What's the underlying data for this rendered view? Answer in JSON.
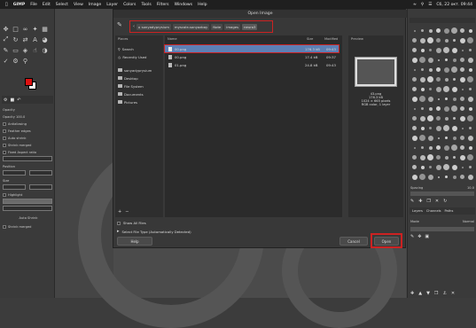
{
  "menubar": {
    "apple": "",
    "items": [
      "GIMP",
      "File",
      "Edit",
      "Select",
      "View",
      "Image",
      "Layer",
      "Colors",
      "Tools",
      "Filters",
      "Windows",
      "Help"
    ],
    "clock": "Сб, 22 окт. 09:44"
  },
  "dialog": {
    "title": "Open Image",
    "path": [
      "sonyadyprysium",
      "myscale-sonyazbay",
      "Note",
      "images",
      "neuro3"
    ],
    "places_header": "Places",
    "places": [
      "Search",
      "Recently Used",
      "sonyadyprysium",
      "Desktop",
      "File System",
      "Documents",
      "Pictures"
    ],
    "columns": {
      "name": "Name",
      "size": "Size",
      "modified": "Modified"
    },
    "files": [
      {
        "name": "00.png",
        "size": "176.3 kB",
        "modified": "09:43",
        "selected": true
      },
      {
        "name": "00.png",
        "size": "17.4 kB",
        "modified": "09:37",
        "selected": false
      },
      {
        "name": "01.png",
        "size": "24.8 kB",
        "modified": "09:43",
        "selected": false
      }
    ],
    "preview_header": "Preview",
    "preview_info": [
      "43.png",
      "176.3 kB",
      "1024 × 665 pixels",
      "RGB color, 1 layer"
    ],
    "show_all": "Show All Files",
    "file_type": "Select File Type (Automatically Detected)",
    "help": "Help",
    "cancel": "Cancel",
    "open": "Open"
  },
  "toolbox": {
    "tool_options_label": "Opacity",
    "options": [
      "Opacity 100.0",
      "Antialiasing",
      "Feather edges",
      "Auto shrink",
      "Shrink merged",
      "Fixed Aspect ratio",
      "Position",
      "Size",
      "Highlight",
      "Auto Shrink"
    ],
    "foreground_color": "#dd1111",
    "background_color": "#ffffff"
  },
  "dock": {
    "spacing_label": "Spacing",
    "spacing_value": "10.0",
    "tabs": [
      "Layers",
      "Channels",
      "Paths"
    ],
    "mode_label": "Mode",
    "mode_value": "Normal"
  },
  "colors": {
    "highlight": "#cc2222",
    "selected_row": "#5d7fb5"
  }
}
